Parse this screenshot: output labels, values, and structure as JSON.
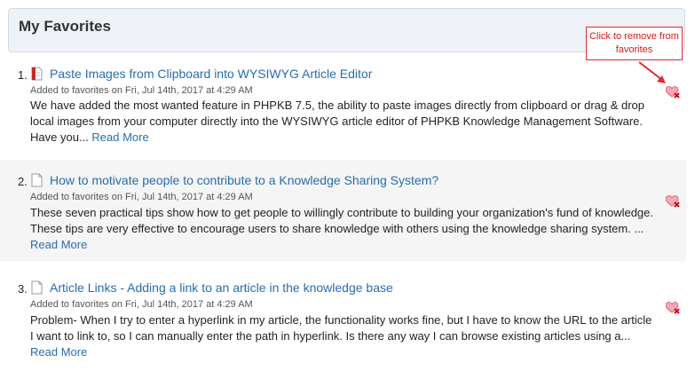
{
  "panel": {
    "title": "My Favorites"
  },
  "callout": {
    "text": "Click to remove from favorites"
  },
  "read_more_label": "Read More",
  "items": [
    {
      "number": "1.",
      "icon": "pdf-document-icon",
      "title": "Paste Images from Clipboard into WYSIWYG Article Editor",
      "meta": "Added to favorites on Fri, Jul 14th, 2017 at 4:29 AM",
      "summary": "We have added the most wanted feature in PHPKB 7.5, the ability to paste images directly from clipboard or drag & drop local images from your computer directly into the WYSIWYG article editor of PHPKB Knowledge Management Software. Have you..."
    },
    {
      "number": "2.",
      "icon": "document-icon",
      "title": "How to motivate people to contribute to a Knowledge Sharing System?",
      "meta": "Added to favorites on Fri, Jul 14th, 2017 at 4:29 AM",
      "summary": "These seven practical tips show how to get people to willingly contribute to building your organization's fund of knowledge. These tips are very effective to encourage users to share knowledge with others using the knowledge sharing system. ..."
    },
    {
      "number": "3.",
      "icon": "document-icon",
      "title": "Article Links - Adding a link to an article in the knowledge base",
      "meta": "Added to favorites on Fri, Jul 14th, 2017 at 4:29 AM",
      "summary": "Problem- When I try to enter a hyperlink in my article, the functionality works fine, but I have to know the URL to the article I want to link to, so I can manually enter the path in hyperlink. Is there any way I can browse existing articles using a..."
    }
  ],
  "colors": {
    "link": "#2a6cae",
    "callout_border": "#e32a2a",
    "remove_icon": "#e0506a"
  }
}
